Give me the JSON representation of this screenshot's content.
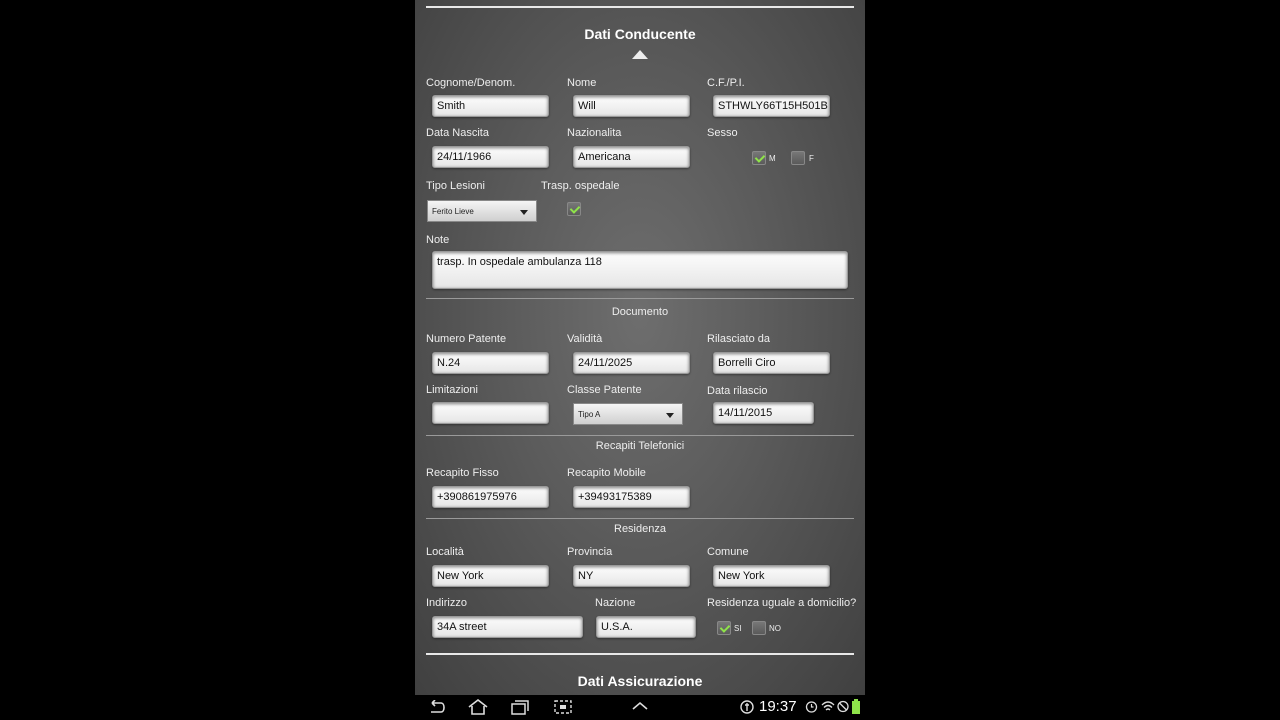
{
  "conducente": {
    "title": "Dati Conducente",
    "cognome_label": "Cognome/Denom.",
    "cognome": "Smith",
    "nome_label": "Nome",
    "nome": "Will",
    "cf_label": "C.F./P.I.",
    "cf": "STHWLY66T15H501B",
    "data_nascita_label": "Data Nascita",
    "data_nascita": "24/11/1966",
    "nazionalita_label": "Nazionalita",
    "nazionalita": "Americana",
    "sesso_label": "Sesso",
    "sesso_m": "M",
    "sesso_f": "F",
    "sesso_selected": "M",
    "tipo_lesioni_label": "Tipo Lesioni",
    "tipo_lesioni": "Ferito Lieve",
    "trasp_label": "Trasp. ospedale",
    "trasp_checked": true,
    "note_label": "Note",
    "note": "trasp. In ospedale ambulanza 118"
  },
  "documento": {
    "title": "Documento",
    "numero_label": "Numero Patente",
    "numero": "N.24",
    "validita_label": "Validità",
    "validita": "24/11/2025",
    "rilasciato_label": "Rilasciato da",
    "rilasciato": "Borrelli Ciro",
    "limitazioni_label": "Limitazioni",
    "limitazioni": "",
    "classe_label": "Classe Patente",
    "classe": "Tipo A",
    "data_rilascio_label": "Data rilascio",
    "data_rilascio": "14/11/2015"
  },
  "recapiti": {
    "title": "Recapiti Telefonici",
    "fisso_label": "Recapito Fisso",
    "fisso": "+390861975976",
    "mobile_label": "Recapito Mobile",
    "mobile": "+39493175389"
  },
  "residenza": {
    "title": "Residenza",
    "localita_label": "Località",
    "localita": "New York",
    "provincia_label": "Provincia",
    "provincia": "NY",
    "comune_label": "Comune",
    "comune": "New York",
    "indirizzo_label": "Indirizzo",
    "indirizzo": "34A street",
    "nazione_label": "Nazione",
    "nazione": "U.S.A.",
    "uguale_label": "Residenza uguale a domicilio?",
    "si": "SI",
    "no": "NO",
    "uguale_selected": "SI"
  },
  "assicurazione": {
    "title": "Dati Assicurazione"
  },
  "system": {
    "time": "19:37"
  },
  "colors": {
    "check": "#8fe34a",
    "background": "#5a5a5a"
  }
}
